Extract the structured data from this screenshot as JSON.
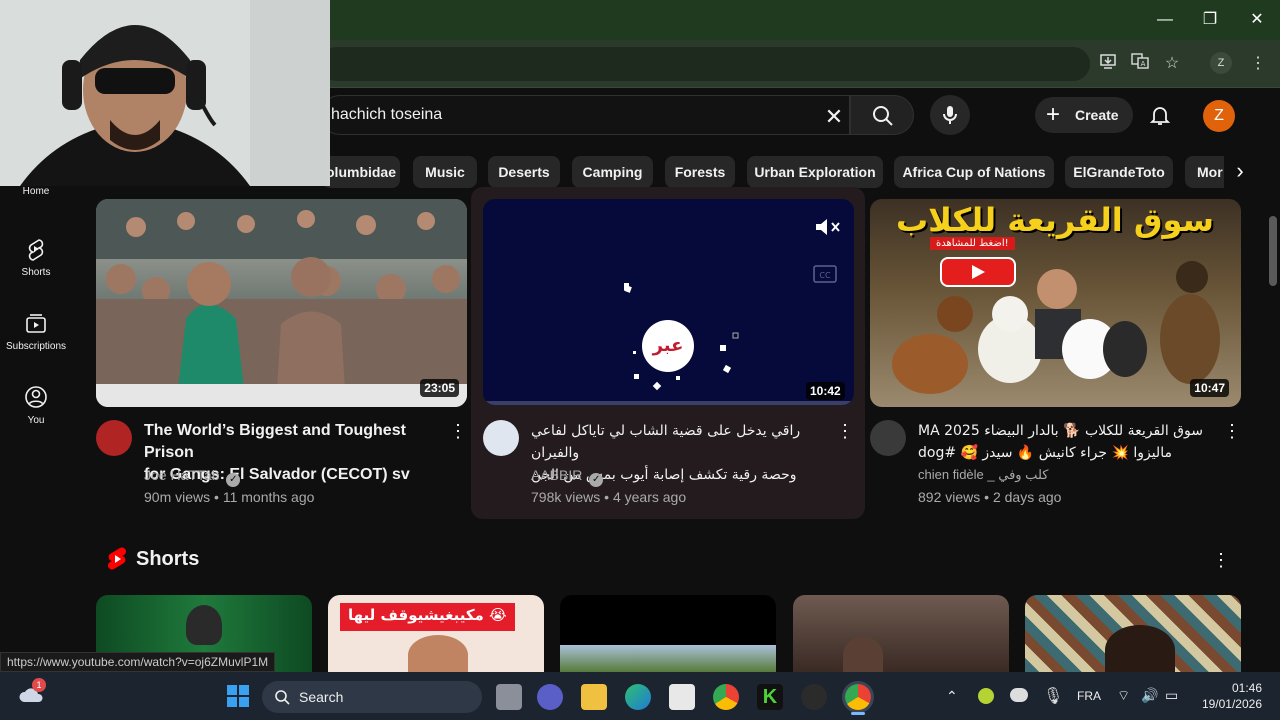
{
  "window": {
    "minimize": "—",
    "restore": "❐",
    "close": "✕"
  },
  "browser": {
    "profile_initial": "Z"
  },
  "header": {
    "search_query": "hachich toseina",
    "create_label": "Create",
    "avatar_initial": "Z"
  },
  "chips": [
    "olumbidae",
    "Music",
    "Deserts",
    "Camping",
    "Forests",
    "Urban Exploration",
    "Africa Cup of Nations",
    "ElGrandeToto",
    "Mor"
  ],
  "sidebar": {
    "items": [
      {
        "label": "Home",
        "icon": "home-icon"
      },
      {
        "label": "Shorts",
        "icon": "shorts-icon"
      },
      {
        "label": "Subscriptions",
        "icon": "subscriptions-icon"
      },
      {
        "label": "You",
        "icon": "you-icon"
      }
    ]
  },
  "videos": [
    {
      "title_line1": "The World’s Biggest and Toughest Prison",
      "title_line2": "for Gangs: El Salvador (CECOT) sv",
      "channel": "Joe HaTTab",
      "verified": true,
      "views": "90m views",
      "age": "11 months ago",
      "duration": "23:05"
    },
    {
      "title_line1": "راقي يدخل على قضية الشاب لي تاياكل لفاعي والفيران",
      "title_line2": "وحصة رقية تكشف إصابة أيوب بمس من الجن",
      "channel": "AABBIR",
      "verified": true,
      "views": "798k views",
      "age": "4 years ago",
      "duration": "10:42",
      "thumb_logo": "عبر"
    },
    {
      "title_line1": "سوق القريعة للكلاب 🐕 بالدار البيضاء MA 2025",
      "title_line2": "ماليزوا 💥 جراء كانيش 🔥 سيدز 🥰 #dog",
      "channel": "chien fidèle _ كلب وفي",
      "verified": false,
      "views": "892 views",
      "age": "2 days ago",
      "duration": "10:47",
      "thumb_banner": "سوق القريعة للكلاب",
      "thumb_sub": "اضغط للمشاهدة!"
    }
  ],
  "shorts": {
    "section_title": "Shorts",
    "second_caption": "مكيبغيشيوقف ليها 😭"
  },
  "statusbar": {
    "url": "https://www.youtube.com/watch?v=oj6ZMuvlP1M"
  },
  "taskbar": {
    "search_label": "Search",
    "lang": "FRA",
    "time": "01:46",
    "date": "19/01/2026",
    "weather_badge": "1"
  },
  "colors": {
    "accent": "#ff0000",
    "avatar": "#e0620a",
    "background": "#0f0f0f",
    "chip": "#272727"
  }
}
